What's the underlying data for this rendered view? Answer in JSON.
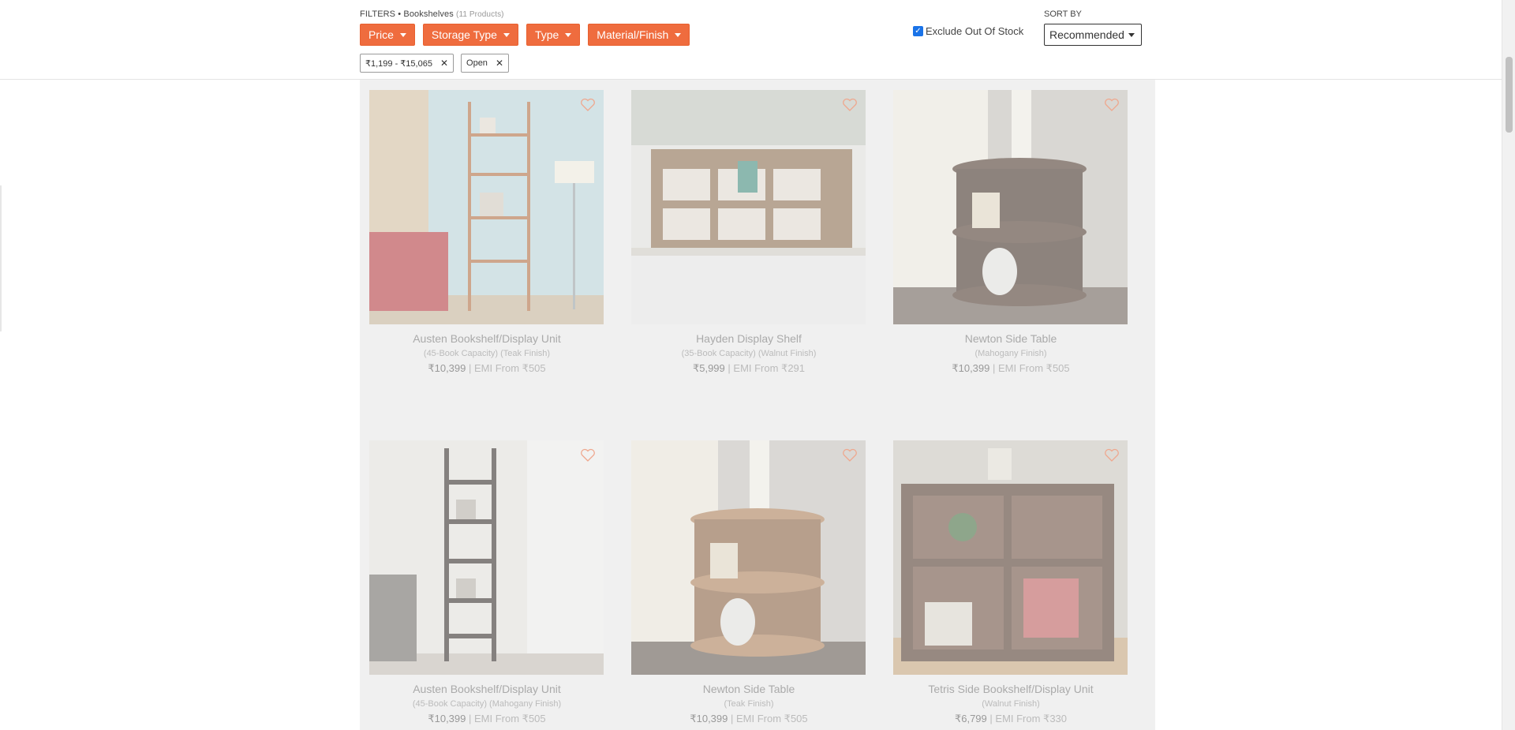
{
  "filters": {
    "label": "FILTERS • Bookshelves",
    "count": "(11 Products)",
    "buttons": [
      "Price",
      "Storage Type",
      "Type",
      "Material/Finish"
    ],
    "chips": [
      "₹1,199 - ₹15,065",
      "Open"
    ],
    "exclude_out_of_stock": {
      "label": "Exclude Out Of Stock",
      "checked": true
    }
  },
  "sort": {
    "label": "SORT BY",
    "value": "Recommended"
  },
  "products": [
    {
      "name": "Austen Bookshelf/Display Unit",
      "variant": "(45-Book Capacity) (Teak Finish)",
      "price": "₹10,399",
      "emi": "| EMI From ₹505"
    },
    {
      "name": "Hayden Display Shelf",
      "variant": "(35-Book Capacity) (Walnut Finish)",
      "price": "₹5,999",
      "emi": "| EMI From ₹291"
    },
    {
      "name": "Newton Side Table",
      "variant": "(Mahogany Finish)",
      "price": "₹10,399",
      "emi": "| EMI From ₹505"
    },
    {
      "name": "Austen Bookshelf/Display Unit",
      "variant": "(45-Book Capacity) (Mahogany Finish)",
      "price": "₹10,399",
      "emi": "| EMI From ₹505"
    },
    {
      "name": "Newton Side Table",
      "variant": "(Teak Finish)",
      "price": "₹10,399",
      "emi": "| EMI From ₹505"
    },
    {
      "name": "Tetris Side Bookshelf/Display Unit",
      "variant": "(Walnut Finish)",
      "price": "₹6,799",
      "emi": "| EMI From ₹330"
    }
  ],
  "colors": {
    "accent": "#ef6c3e",
    "listing_bg": "#f0f0f0"
  },
  "icons": {
    "wishlist": "heart-outline-icon",
    "remove": "close-icon",
    "dropdown": "caret-down-icon"
  }
}
